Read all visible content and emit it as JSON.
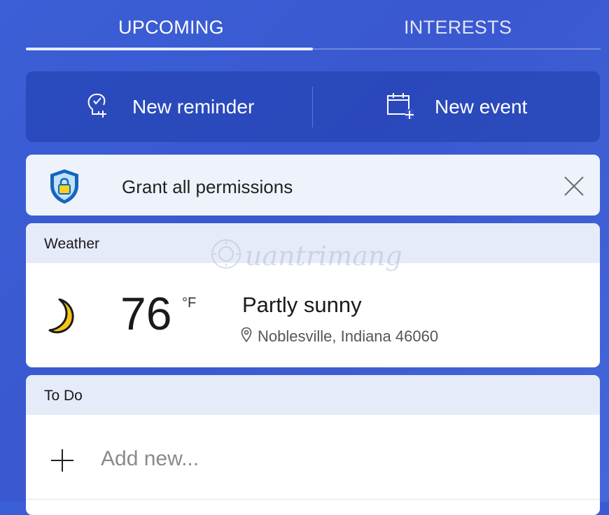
{
  "tabs": [
    {
      "label": "UPCOMING",
      "active": true
    },
    {
      "label": "INTERESTS",
      "active": false
    }
  ],
  "actions": {
    "reminder_label": "New reminder",
    "reminder_icon": "reminder-bulb-plus-icon",
    "event_label": "New event",
    "event_icon": "calendar-plus-icon"
  },
  "permissions": {
    "label": "Grant all permissions",
    "icon": "shield-lock-icon",
    "close_icon": "close-icon"
  },
  "weather": {
    "header": "Weather",
    "temperature": "76",
    "unit": "°F",
    "condition": "Partly sunny",
    "location": "Noblesville, Indiana 46060",
    "icon": "moon-icon"
  },
  "todo": {
    "header": "To Do",
    "add_placeholder": "Add new..."
  },
  "watermark": {
    "text": "uantrimang"
  },
  "colors": {
    "background": "#3b5fd6",
    "card": "#ffffff",
    "card_header": "#e6ebfa",
    "moon": "#f5c518",
    "shield": "#1565c0"
  }
}
